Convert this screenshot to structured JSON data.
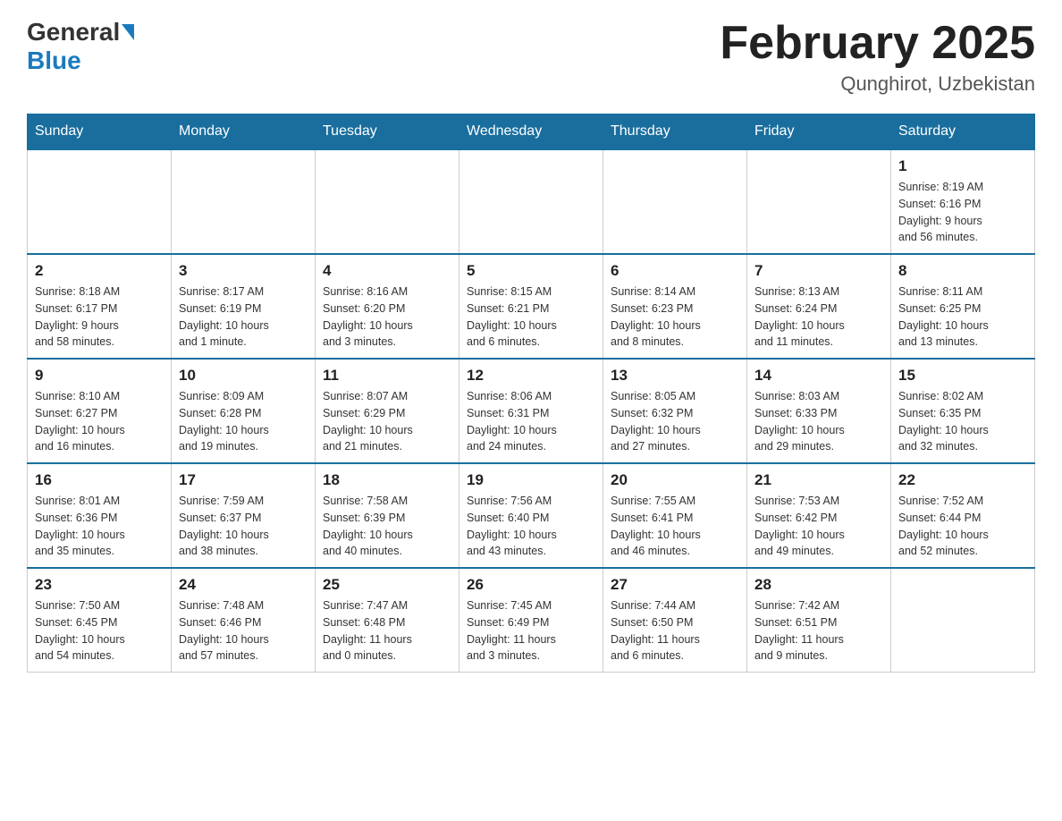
{
  "header": {
    "logo_general": "General",
    "logo_blue": "Blue",
    "month_title": "February 2025",
    "location": "Qunghirot, Uzbekistan"
  },
  "days_of_week": [
    "Sunday",
    "Monday",
    "Tuesday",
    "Wednesday",
    "Thursday",
    "Friday",
    "Saturday"
  ],
  "weeks": [
    [
      {
        "day": "",
        "info": "",
        "empty": true
      },
      {
        "day": "",
        "info": "",
        "empty": true
      },
      {
        "day": "",
        "info": "",
        "empty": true
      },
      {
        "day": "",
        "info": "",
        "empty": true
      },
      {
        "day": "",
        "info": "",
        "empty": true
      },
      {
        "day": "",
        "info": "",
        "empty": true
      },
      {
        "day": "1",
        "info": "Sunrise: 8:19 AM\nSunset: 6:16 PM\nDaylight: 9 hours\nand 56 minutes.",
        "empty": false
      }
    ],
    [
      {
        "day": "2",
        "info": "Sunrise: 8:18 AM\nSunset: 6:17 PM\nDaylight: 9 hours\nand 58 minutes.",
        "empty": false
      },
      {
        "day": "3",
        "info": "Sunrise: 8:17 AM\nSunset: 6:19 PM\nDaylight: 10 hours\nand 1 minute.",
        "empty": false
      },
      {
        "day": "4",
        "info": "Sunrise: 8:16 AM\nSunset: 6:20 PM\nDaylight: 10 hours\nand 3 minutes.",
        "empty": false
      },
      {
        "day": "5",
        "info": "Sunrise: 8:15 AM\nSunset: 6:21 PM\nDaylight: 10 hours\nand 6 minutes.",
        "empty": false
      },
      {
        "day": "6",
        "info": "Sunrise: 8:14 AM\nSunset: 6:23 PM\nDaylight: 10 hours\nand 8 minutes.",
        "empty": false
      },
      {
        "day": "7",
        "info": "Sunrise: 8:13 AM\nSunset: 6:24 PM\nDaylight: 10 hours\nand 11 minutes.",
        "empty": false
      },
      {
        "day": "8",
        "info": "Sunrise: 8:11 AM\nSunset: 6:25 PM\nDaylight: 10 hours\nand 13 minutes.",
        "empty": false
      }
    ],
    [
      {
        "day": "9",
        "info": "Sunrise: 8:10 AM\nSunset: 6:27 PM\nDaylight: 10 hours\nand 16 minutes.",
        "empty": false
      },
      {
        "day": "10",
        "info": "Sunrise: 8:09 AM\nSunset: 6:28 PM\nDaylight: 10 hours\nand 19 minutes.",
        "empty": false
      },
      {
        "day": "11",
        "info": "Sunrise: 8:07 AM\nSunset: 6:29 PM\nDaylight: 10 hours\nand 21 minutes.",
        "empty": false
      },
      {
        "day": "12",
        "info": "Sunrise: 8:06 AM\nSunset: 6:31 PM\nDaylight: 10 hours\nand 24 minutes.",
        "empty": false
      },
      {
        "day": "13",
        "info": "Sunrise: 8:05 AM\nSunset: 6:32 PM\nDaylight: 10 hours\nand 27 minutes.",
        "empty": false
      },
      {
        "day": "14",
        "info": "Sunrise: 8:03 AM\nSunset: 6:33 PM\nDaylight: 10 hours\nand 29 minutes.",
        "empty": false
      },
      {
        "day": "15",
        "info": "Sunrise: 8:02 AM\nSunset: 6:35 PM\nDaylight: 10 hours\nand 32 minutes.",
        "empty": false
      }
    ],
    [
      {
        "day": "16",
        "info": "Sunrise: 8:01 AM\nSunset: 6:36 PM\nDaylight: 10 hours\nand 35 minutes.",
        "empty": false
      },
      {
        "day": "17",
        "info": "Sunrise: 7:59 AM\nSunset: 6:37 PM\nDaylight: 10 hours\nand 38 minutes.",
        "empty": false
      },
      {
        "day": "18",
        "info": "Sunrise: 7:58 AM\nSunset: 6:39 PM\nDaylight: 10 hours\nand 40 minutes.",
        "empty": false
      },
      {
        "day": "19",
        "info": "Sunrise: 7:56 AM\nSunset: 6:40 PM\nDaylight: 10 hours\nand 43 minutes.",
        "empty": false
      },
      {
        "day": "20",
        "info": "Sunrise: 7:55 AM\nSunset: 6:41 PM\nDaylight: 10 hours\nand 46 minutes.",
        "empty": false
      },
      {
        "day": "21",
        "info": "Sunrise: 7:53 AM\nSunset: 6:42 PM\nDaylight: 10 hours\nand 49 minutes.",
        "empty": false
      },
      {
        "day": "22",
        "info": "Sunrise: 7:52 AM\nSunset: 6:44 PM\nDaylight: 10 hours\nand 52 minutes.",
        "empty": false
      }
    ],
    [
      {
        "day": "23",
        "info": "Sunrise: 7:50 AM\nSunset: 6:45 PM\nDaylight: 10 hours\nand 54 minutes.",
        "empty": false
      },
      {
        "day": "24",
        "info": "Sunrise: 7:48 AM\nSunset: 6:46 PM\nDaylight: 10 hours\nand 57 minutes.",
        "empty": false
      },
      {
        "day": "25",
        "info": "Sunrise: 7:47 AM\nSunset: 6:48 PM\nDaylight: 11 hours\nand 0 minutes.",
        "empty": false
      },
      {
        "day": "26",
        "info": "Sunrise: 7:45 AM\nSunset: 6:49 PM\nDaylight: 11 hours\nand 3 minutes.",
        "empty": false
      },
      {
        "day": "27",
        "info": "Sunrise: 7:44 AM\nSunset: 6:50 PM\nDaylight: 11 hours\nand 6 minutes.",
        "empty": false
      },
      {
        "day": "28",
        "info": "Sunrise: 7:42 AM\nSunset: 6:51 PM\nDaylight: 11 hours\nand 9 minutes.",
        "empty": false
      },
      {
        "day": "",
        "info": "",
        "empty": true
      }
    ]
  ]
}
